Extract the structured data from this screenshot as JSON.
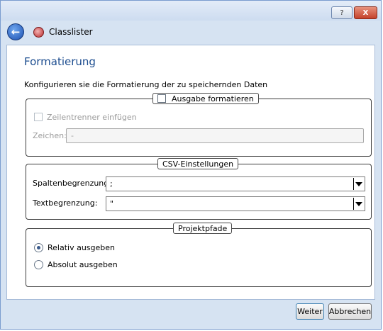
{
  "window": {
    "help_icon": "?",
    "close_icon": "X"
  },
  "navbar": {
    "back_icon": "back-arrow-icon",
    "title": "Classlister"
  },
  "page": {
    "title": "Formatierung",
    "description": "Konfigurieren sie die Formatierung der zu speichernden Daten"
  },
  "format_group": {
    "legend": "Ausgabe formatieren",
    "line_sep_label": "Zeilentrenner einfügen",
    "chars_label": "Zeichen:",
    "chars_value": "-"
  },
  "csv_group": {
    "legend": "CSV-Einstellungen",
    "column_label": "Spaltenbegrenzung:",
    "column_value": ";",
    "text_label": "Textbegrenzung:",
    "text_value": "\""
  },
  "path_group": {
    "legend": "Projektpfade",
    "relative_label": "Relativ ausgeben",
    "absolute_label": "Absolut ausgeben",
    "selected": "relative"
  },
  "footer": {
    "next_label": "Weiter",
    "cancel_label": "Abbrechen"
  }
}
